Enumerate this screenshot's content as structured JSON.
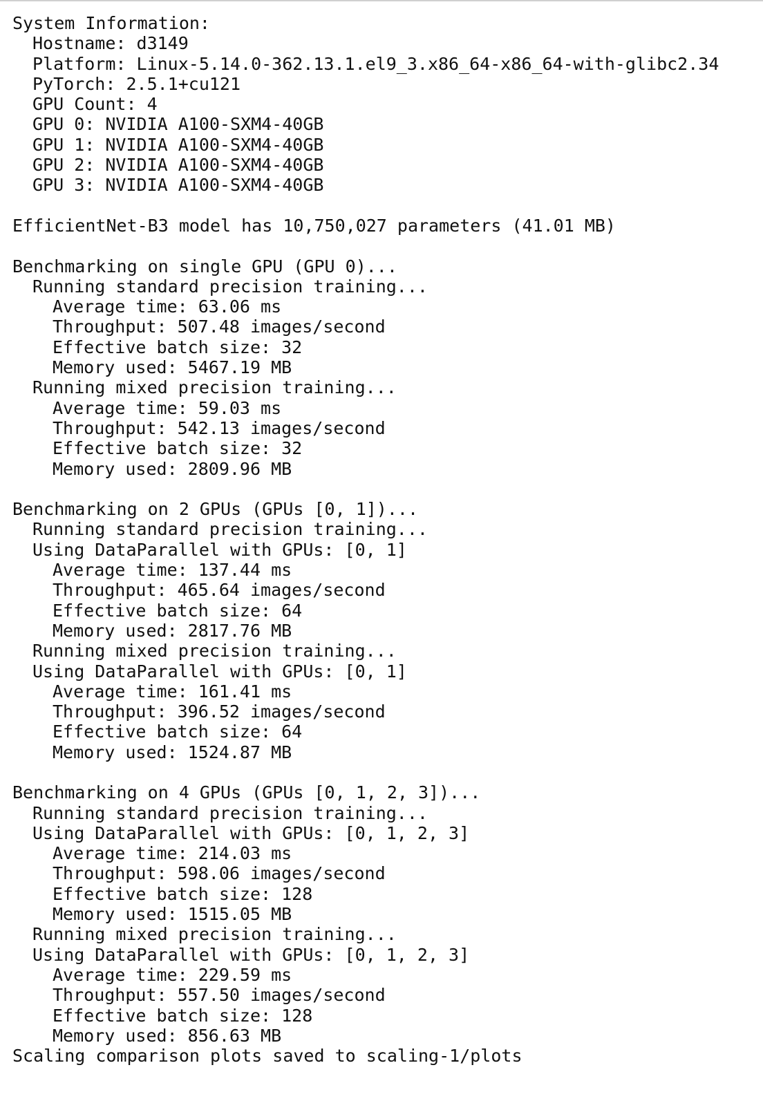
{
  "terminal": {
    "lines": [
      {
        "text": "System Information:",
        "indent": 0
      },
      {
        "text": "Hostname: d3149",
        "indent": 1
      },
      {
        "text": "Platform: Linux-5.14.0-362.13.1.el9_3.x86_64-x86_64-with-glibc2.34",
        "indent": 1
      },
      {
        "text": "PyTorch: 2.5.1+cu121",
        "indent": 1
      },
      {
        "text": "GPU Count: 4",
        "indent": 1
      },
      {
        "text": "GPU 0: NVIDIA A100-SXM4-40GB",
        "indent": 1
      },
      {
        "text": "GPU 1: NVIDIA A100-SXM4-40GB",
        "indent": 1
      },
      {
        "text": "GPU 2: NVIDIA A100-SXM4-40GB",
        "indent": 1
      },
      {
        "text": "GPU 3: NVIDIA A100-SXM4-40GB",
        "indent": 1
      },
      {
        "text": "",
        "indent": 0
      },
      {
        "text": "EfficientNet-B3 model has 10,750,027 parameters (41.01 MB)",
        "indent": 0
      },
      {
        "text": "",
        "indent": 0
      },
      {
        "text": "Benchmarking on single GPU (GPU 0)...",
        "indent": 0
      },
      {
        "text": "Running standard precision training...",
        "indent": 1
      },
      {
        "text": "Average time: 63.06 ms",
        "indent": 2
      },
      {
        "text": "Throughput: 507.48 images/second",
        "indent": 2
      },
      {
        "text": "Effective batch size: 32",
        "indent": 2
      },
      {
        "text": "Memory used: 5467.19 MB",
        "indent": 2
      },
      {
        "text": "Running mixed precision training...",
        "indent": 1
      },
      {
        "text": "Average time: 59.03 ms",
        "indent": 2
      },
      {
        "text": "Throughput: 542.13 images/second",
        "indent": 2
      },
      {
        "text": "Effective batch size: 32",
        "indent": 2
      },
      {
        "text": "Memory used: 2809.96 MB",
        "indent": 2
      },
      {
        "text": "",
        "indent": 0
      },
      {
        "text": "Benchmarking on 2 GPUs (GPUs [0, 1])...",
        "indent": 0
      },
      {
        "text": "Running standard precision training...",
        "indent": 1
      },
      {
        "text": "Using DataParallel with GPUs: [0, 1]",
        "indent": 1
      },
      {
        "text": "Average time: 137.44 ms",
        "indent": 2
      },
      {
        "text": "Throughput: 465.64 images/second",
        "indent": 2
      },
      {
        "text": "Effective batch size: 64",
        "indent": 2
      },
      {
        "text": "Memory used: 2817.76 MB",
        "indent": 2
      },
      {
        "text": "Running mixed precision training...",
        "indent": 1
      },
      {
        "text": "Using DataParallel with GPUs: [0, 1]",
        "indent": 1
      },
      {
        "text": "Average time: 161.41 ms",
        "indent": 2
      },
      {
        "text": "Throughput: 396.52 images/second",
        "indent": 2
      },
      {
        "text": "Effective batch size: 64",
        "indent": 2
      },
      {
        "text": "Memory used: 1524.87 MB",
        "indent": 2
      },
      {
        "text": "",
        "indent": 0
      },
      {
        "text": "Benchmarking on 4 GPUs (GPUs [0, 1, 2, 3])...",
        "indent": 0
      },
      {
        "text": "Running standard precision training...",
        "indent": 1
      },
      {
        "text": "Using DataParallel with GPUs: [0, 1, 2, 3]",
        "indent": 1
      },
      {
        "text": "Average time: 214.03 ms",
        "indent": 2
      },
      {
        "text": "Throughput: 598.06 images/second",
        "indent": 2
      },
      {
        "text": "Effective batch size: 128",
        "indent": 2
      },
      {
        "text": "Memory used: 1515.05 MB",
        "indent": 2
      },
      {
        "text": "Running mixed precision training...",
        "indent": 1
      },
      {
        "text": "Using DataParallel with GPUs: [0, 1, 2, 3]",
        "indent": 1
      },
      {
        "text": "Average time: 229.59 ms",
        "indent": 2
      },
      {
        "text": "Throughput: 557.50 images/second",
        "indent": 2
      },
      {
        "text": "Effective batch size: 128",
        "indent": 2
      },
      {
        "text": "Memory used: 856.63 MB",
        "indent": 2
      },
      {
        "text": "Scaling comparison plots saved to scaling-1/plots",
        "indent": 0
      }
    ]
  }
}
